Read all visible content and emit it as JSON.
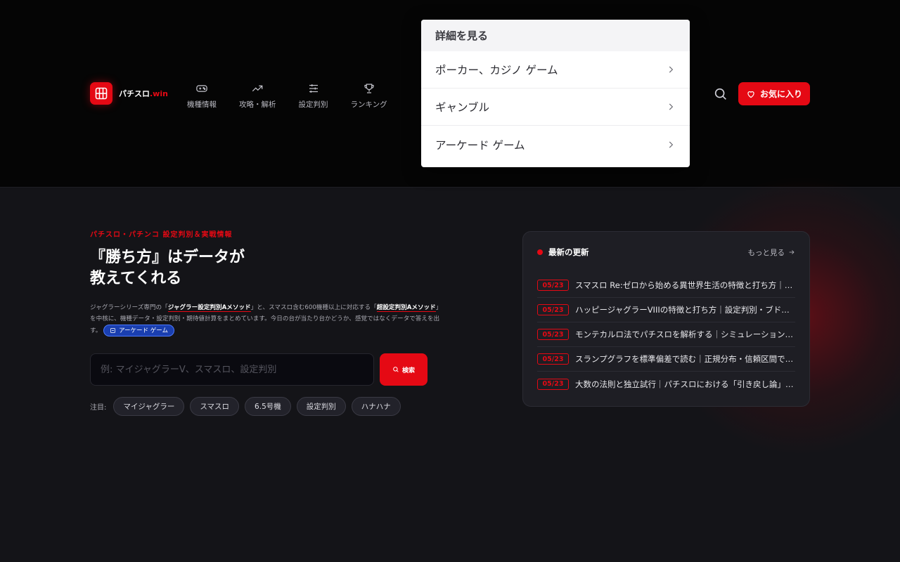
{
  "brand": {
    "name_main": "パチスロ",
    "name_accent": ".win",
    "logo_icon": "grid-icon",
    "accent_color": "#e50914"
  },
  "nav": [
    {
      "label": "機種情報",
      "icon": "gamepad-icon"
    },
    {
      "label": "攻略・解析",
      "icon": "trending-up-icon"
    },
    {
      "label": "設定判別",
      "icon": "sliders-icon"
    },
    {
      "label": "ランキング",
      "icon": "trophy-icon"
    }
  ],
  "header": {
    "search_icon": "search-icon",
    "favorite_label": "お気に入り",
    "favorite_icon": "heart-icon"
  },
  "dropdown": {
    "title": "詳細を見る",
    "items": [
      {
        "label": "ポーカー、カジノ ゲーム"
      },
      {
        "label": "ギャンブル"
      },
      {
        "label": "アーケード ゲーム"
      }
    ]
  },
  "hero": {
    "eyebrow": "パチスロ・パチンコ 設定判別＆実戦情報",
    "title_line1": "『勝ち方』はデータが",
    "title_line2": "教えてくれる",
    "desc_part1": "ジャグラーシリーズ専門の「",
    "desc_hl1": "ジャグラー設定判別Aメソッド",
    "desc_part2": "」と、スマスロ含む600機種以上に対応する「",
    "desc_hl2": "超設定判別Aメソッド",
    "desc_part3": "」を中核に、機種データ・設定判別・期待値計算をまとめています。今日の台が当たり台かどうか、感覚ではなくデータで答えを出す。",
    "chip_label": "アーケード ゲーム"
  },
  "search": {
    "placeholder": "例: マイジャグラーV、スマスロ、設定判別",
    "button_label": "検索"
  },
  "tags": {
    "label": "注目:",
    "items": [
      "マイジャグラー",
      "スマスロ",
      "6.5号機",
      "設定判別",
      "ハナハナ"
    ]
  },
  "updates": {
    "title": "最新の更新",
    "more_label": "もっと見る",
    "items": [
      {
        "date": "05/23",
        "title": "スマスロ Re:ゼロから始める異世界生活の特徴と打ち方｜…"
      },
      {
        "date": "05/23",
        "title": "ハッピージャグラーVIIIの特徴と打ち方｜設定判別・ブド…"
      },
      {
        "date": "05/23",
        "title": "モンテカルロ法でパチスロを解析する｜シミュレーション…"
      },
      {
        "date": "05/23",
        "title": "スランプグラフを標準偏差で読む｜正規分布・信頼区間で…"
      },
      {
        "date": "05/23",
        "title": "大数の法則と独立試行｜パチスロにおける「引き戻し論」…"
      }
    ]
  }
}
